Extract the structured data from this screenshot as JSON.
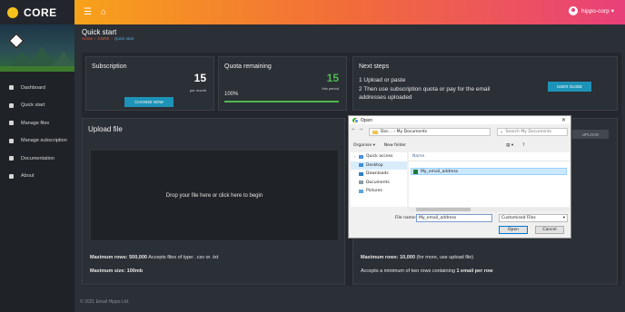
{
  "brand": {
    "name": "CORE"
  },
  "topbar": {
    "user": "hippo-corp"
  },
  "sidebar": {
    "items": [
      {
        "label": "Dashboard"
      },
      {
        "label": "Quick start"
      },
      {
        "label": "Manage files"
      },
      {
        "label": "Manage subscription"
      },
      {
        "label": "Documentation"
      },
      {
        "label": "About"
      }
    ]
  },
  "page": {
    "title": "Quick start",
    "breadcrumb": [
      "Home",
      "CORE",
      "Quick start"
    ]
  },
  "subscription": {
    "title": "Subscription",
    "value": "15",
    "unit": "per month",
    "button": "CHANGE NOW"
  },
  "quota": {
    "title": "Quota remaining",
    "value": "15",
    "unit": "this period",
    "percent_label": "100%",
    "progress": 1.0,
    "color": "#4fb84f"
  },
  "next_steps": {
    "title": "Next steps",
    "lines": [
      "1  Upload or paste",
      "2  Then use subscription quota or pay for the email",
      "    addresses uploaded"
    ],
    "button": "USER GUIDE"
  },
  "upload": {
    "title": "Upload file",
    "dropzone": "Drop your file here or click here to begin",
    "max_rows_label": "Maximum rows: 500,000",
    "max_rows_tail": " Accepts files of type: .csv or .txt",
    "max_size": "Maximum size: 100mb",
    "button": "UPLOAD",
    "paste_max_rows_label": "Maximum rows: 10,000",
    "paste_max_rows_tail": " (for more, use upload file)",
    "paste_note_pre": "Accepts a minimum of two rows containing ",
    "paste_note_bold": "1 email per row"
  },
  "footer": {
    "text": "© 2021 Email Hippo Ltd."
  },
  "dialog": {
    "title": "Open",
    "path": "Doc... › My Documents",
    "search_placeholder": "Search My Documents",
    "organise": "Organise ▾",
    "new_folder": "New folder",
    "tree": [
      "Quick access",
      "Desktop",
      "Downloads",
      "Documents",
      "Pictures"
    ],
    "col_name": "Name",
    "file": "My_email_address",
    "file_name_label": "File name:",
    "file_name_value": "My_email_address",
    "file_type": "Customised Files",
    "open": "Open",
    "cancel": "Cancel"
  },
  "colors": {
    "accent_orange": "#f7a21b",
    "accent_pink": "#e8407a",
    "brand_yellow": "#f4c21a",
    "button_blue": "#1d93b7"
  }
}
